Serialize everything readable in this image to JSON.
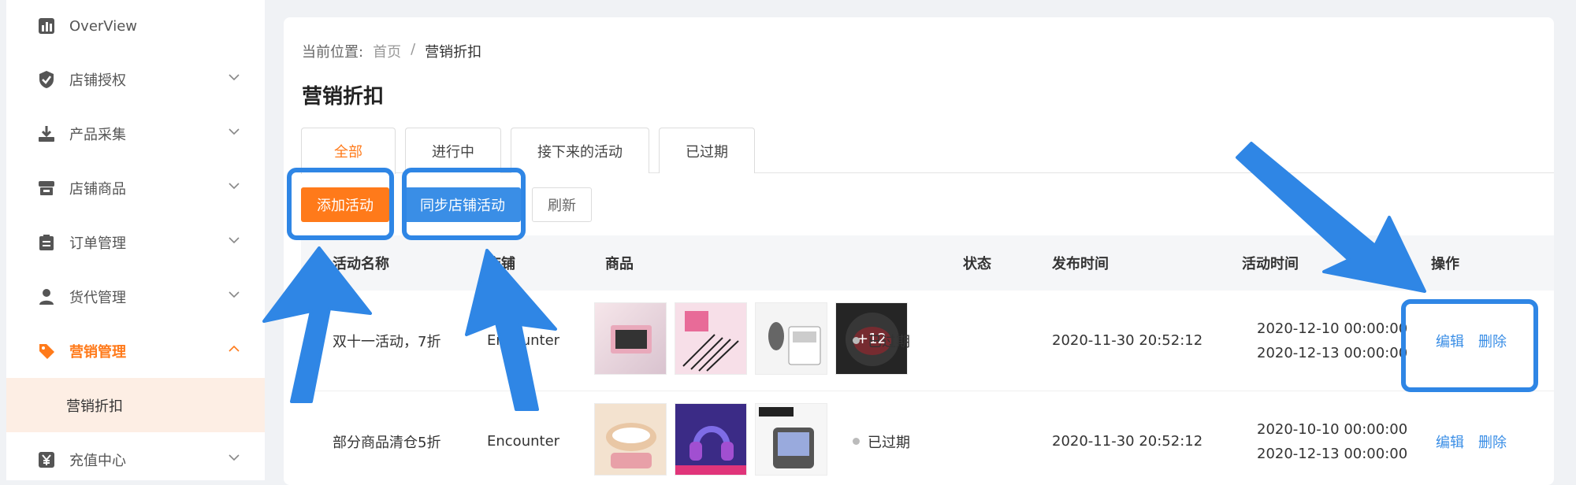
{
  "sidebar": {
    "items": [
      {
        "label": "OverView",
        "icon": "chart-icon"
      },
      {
        "label": "店铺授权",
        "icon": "shield-check-icon"
      },
      {
        "label": "产品采集",
        "icon": "download-icon"
      },
      {
        "label": "店铺商品",
        "icon": "store-icon"
      },
      {
        "label": "订单管理",
        "icon": "clipboard-icon"
      },
      {
        "label": "货代管理",
        "icon": "user-icon"
      },
      {
        "label": "营销管理",
        "icon": "tag-icon"
      },
      {
        "label": "充值中心",
        "icon": "yen-icon"
      }
    ],
    "active_sub": "营销折扣"
  },
  "breadcrumb": {
    "prefix": "当前位置:",
    "home": "首页",
    "sep": "/",
    "current": "营销折扣"
  },
  "page_title": "营销折扣",
  "tabs": [
    "全部",
    "进行中",
    "接下来的活动",
    "已过期"
  ],
  "actions": {
    "add": "添加活动",
    "sync": "同步店铺活动",
    "refresh": "刷新"
  },
  "table": {
    "headers": [
      "活动名称",
      "店铺",
      "商品",
      "状态",
      "发布时间",
      "活动时间",
      "操作"
    ],
    "rows": [
      {
        "name": "双十一活动，7折",
        "store": "Encounter",
        "extra_count": "+12",
        "status": "已过期",
        "published": "2020-11-30 20:52:12",
        "start": "2020-12-10 00:00:00",
        "end": "2020-12-13 00:00:00",
        "edit": "编辑",
        "delete": "删除"
      },
      {
        "name": "部分商品清仓5折",
        "store": "Encounter",
        "status": "已过期",
        "published": "2020-11-30 20:52:12",
        "start": "2020-10-10 00:00:00",
        "end": "2020-12-13 00:00:00",
        "edit": "编辑",
        "delete": "删除"
      }
    ]
  },
  "colors": {
    "accent": "#ff7a1a",
    "primary": "#3a8ee6",
    "annotation": "#2f86e5"
  }
}
